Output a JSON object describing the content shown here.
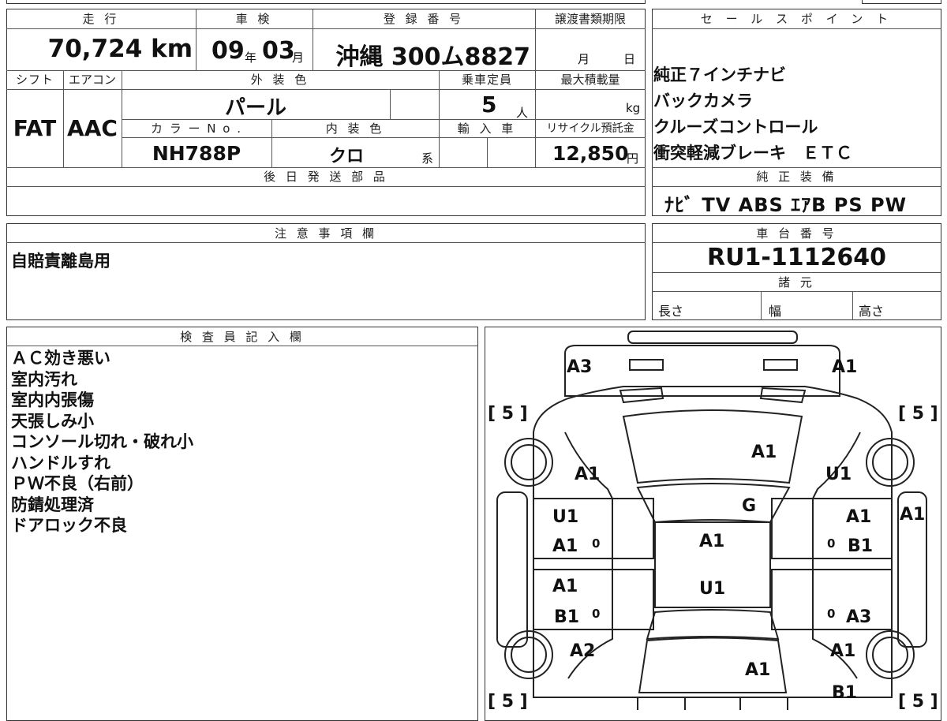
{
  "headers": {
    "mileage": "走 行",
    "inspection": "車 検",
    "registration": "登 録 番 号",
    "transfer_deadline": "譲渡書類期限",
    "shift": "シフト",
    "aircon": "エアコン",
    "exterior_color": "外 装 色",
    "capacity": "乗車定員",
    "max_load": "最大積載量",
    "color_no": "カ ラ ー N o .",
    "interior_color": "内 装 色",
    "import": "輸 入 車",
    "recycle": "リサイクル預託金",
    "later_parts": "後 日 発 送 部 品",
    "sales_points": "セ ー ル ス ポ イ ン ト",
    "factory_equipment": "純 正 装 備",
    "notes": "注 意 事 項 欄",
    "chassis_no": "車 台 番 号",
    "specs": "諸 元",
    "inspector": "検 査 員 記 入 欄"
  },
  "values": {
    "mileage": "70,724 km",
    "inspection_year": "09",
    "year_unit": "年",
    "inspection_month": "03",
    "month_unit": "月",
    "registration": "沖縄 300ム8827",
    "deadline_month_unit": "月",
    "deadline_day_unit": "日",
    "shift": "FAT",
    "aircon": "AAC",
    "exterior_color": "パール",
    "capacity": "5",
    "capacity_unit": "人",
    "load_unit": "kg",
    "color_no": "NH788P",
    "interior_color": "クロ",
    "interior_suffix": "系",
    "recycle": "12,850",
    "recycle_unit": "円",
    "factory_equipment": "ﾅﾋﾞ TV ABS ｴｱB PS PW",
    "notes": "自賠責離島用",
    "chassis_no": "RU1-1112640",
    "spec_length": "長さ",
    "spec_width": "幅",
    "spec_height": "高さ"
  },
  "sales_points": [
    "純正７インチナビ",
    "バックカメラ",
    "クルーズコントロール",
    "衝突軽減ブレーキ　ＥＴＣ"
  ],
  "inspector_notes": [
    "ＡＣ効き悪い",
    "室内汚れ",
    "室内内張傷",
    "天張しみ小",
    "コンソール切れ・破れ小",
    "ハンドルすれ",
    "ＰＷ不良（右前）",
    "防錆処理済",
    "ドアロック不良"
  ],
  "diagram": {
    "tires": [
      "[ 5 ]",
      "[ 5 ]",
      "[ 5 ]",
      "[ 5 ]"
    ],
    "zero": "0",
    "marks": {
      "front_left": "A3",
      "front_right": "A1",
      "hood": "A1",
      "left_fender": "A1",
      "right_fender": "U1",
      "windshield": "G",
      "left_front_door_top": "U1",
      "left_front_door_bottom": "A1",
      "roof": "A1",
      "right_front_door_top": "A1",
      "right_front_door_bottom": "B1",
      "right_side": "A1",
      "left_rear_door_top": "A1",
      "left_rear_door_bottom": "B1",
      "roof_rear": "U1",
      "right_rear_door_top": "A1",
      "right_rear_door_bottom": "A3",
      "left_quarter": "A2",
      "right_quarter": "A1",
      "rear": "A1",
      "right_rear_bottom": "B1"
    }
  }
}
